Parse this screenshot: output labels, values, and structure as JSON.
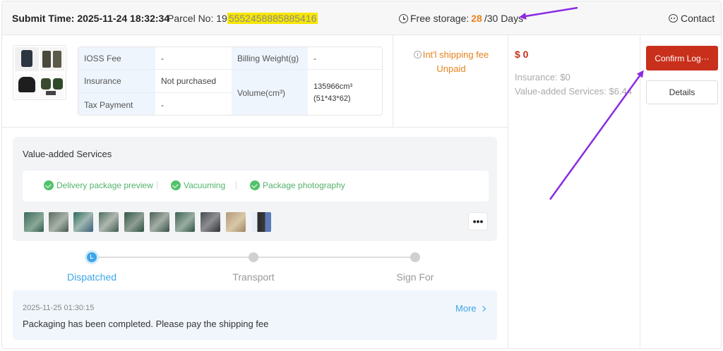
{
  "header": {
    "submit_label": "Submit Time:",
    "submit_time": "2025-11-24 18:32:34",
    "parcel_label": "Parcel No:",
    "parcel_prefix": "19",
    "parcel_masked": "5552458885885416",
    "storage_label": "Free storage:",
    "storage_used": "28",
    "storage_total": "/30 Days",
    "contact_label": "Contact"
  },
  "fees": {
    "ioss_label": "IOSS Fee",
    "ioss_value": "-",
    "insurance_label": "Insurance",
    "insurance_value": "Not purchased",
    "tax_label": "Tax Payment",
    "tax_value": "-",
    "billing_weight_label": "Billing Weight(g)",
    "billing_weight_value": "-",
    "volume_label": "Volume(cm³)",
    "volume_value": "135966cm³",
    "volume_dims": "(51*43*62)"
  },
  "intl_fee": {
    "label": "Int'l shipping fee",
    "status": "Unpaid"
  },
  "summary": {
    "price": "$ 0",
    "insurance": "Insurance: $0",
    "value_added": "Value-added Services: $6.44"
  },
  "actions": {
    "confirm_label": "Confirm Log···",
    "details_label": "Details"
  },
  "value_added": {
    "title": "Value-added Services",
    "services": [
      "Delivery package preview",
      "Vacuuming",
      "Package photography"
    ],
    "more_label": "•••"
  },
  "progress": {
    "steps": [
      "Dispatched",
      "Transport",
      "Sign For"
    ],
    "current_step": 0
  },
  "tracking": {
    "time": "2025-11-25 01:30:15",
    "message": "Packaging has been completed. Please pay the shipping fee",
    "more_label": "More"
  },
  "colors": {
    "accent_red": "#c8301c",
    "accent_orange": "#e6821e",
    "accent_blue": "#3ea6e8",
    "success_green": "#52c26b",
    "annotation_purple": "#8a2be2",
    "highlight_yellow": "#f7e600"
  }
}
